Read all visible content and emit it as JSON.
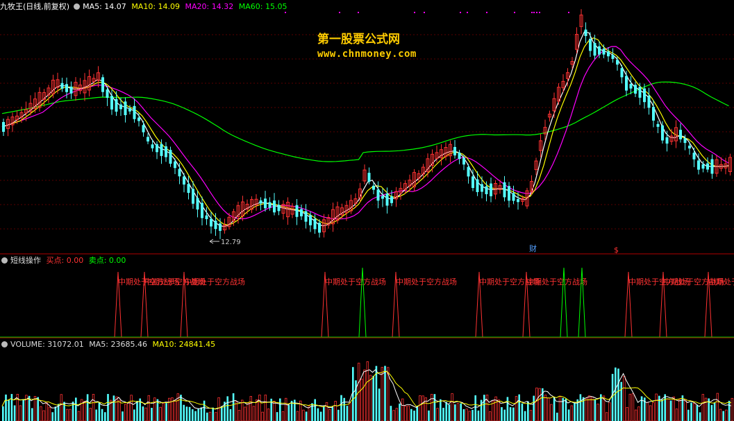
{
  "header_main": {
    "title": "九牧王(日线,前复权)",
    "ma5": "MA5: 14.07",
    "ma10": "MA10: 14.09",
    "ma20": "MA20: 14.32",
    "ma60": "MA60: 15.05"
  },
  "watermark": {
    "line1": "第一股票公式网",
    "line2": "www.chnmoney.com"
  },
  "price_panel": {
    "low_label": "12.79",
    "marker_cai": "财",
    "marker_s": "$"
  },
  "header_signal": {
    "title": "短线操作",
    "buy": "买点: 0.00",
    "sell": "卖点: 0.00"
  },
  "signal_label": "中期处于空方战场",
  "header_volume": {
    "vol": "VOLUME: 31072.01",
    "ma5": "MA5: 23685.46",
    "ma10": "MA10: 24841.45"
  },
  "colors": {
    "up": "#ff3232",
    "down": "#54ffff",
    "ma5": "#ffffff",
    "ma10": "#ffff00",
    "ma20": "#ff00ff",
    "ma60": "#00ff00",
    "buy": "#ff3232",
    "sell": "#00ff00"
  }
}
